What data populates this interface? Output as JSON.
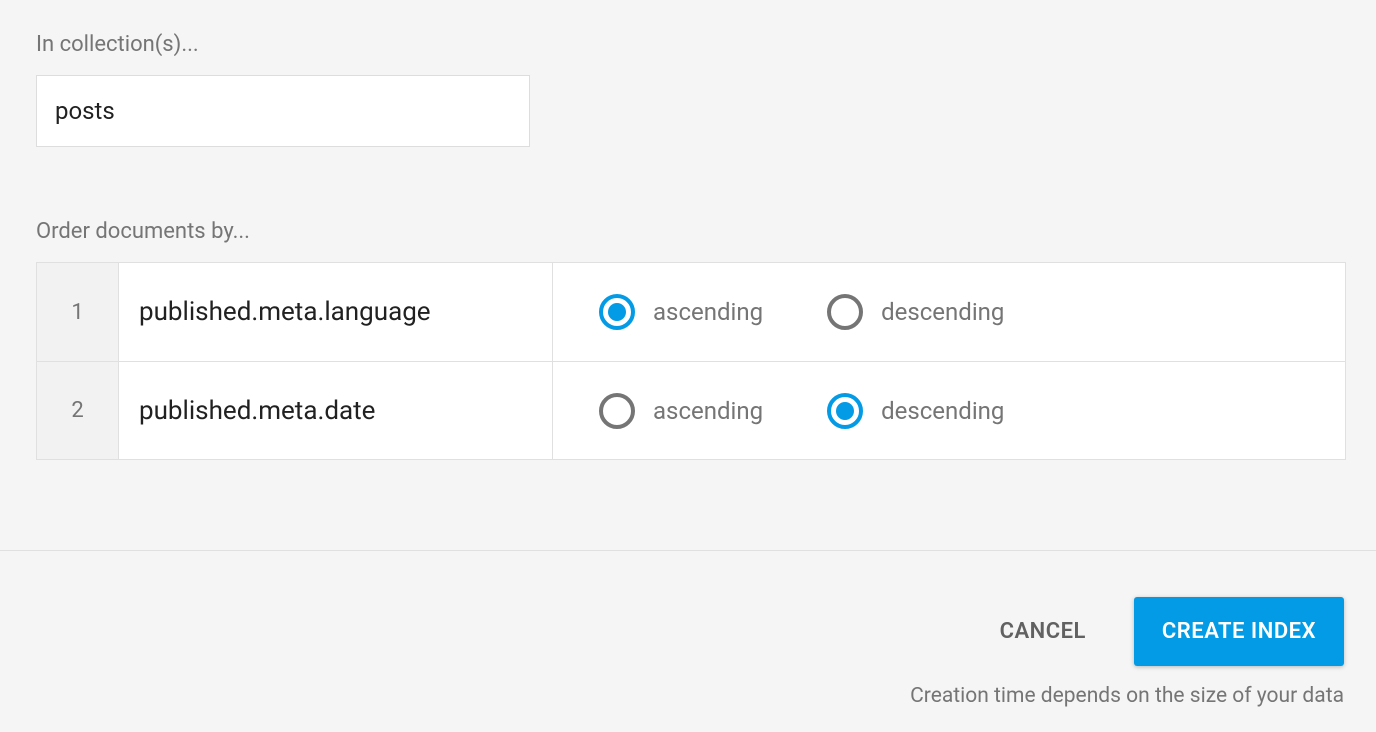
{
  "collection": {
    "label": "In collection(s)...",
    "value": "posts"
  },
  "order": {
    "label": "Order documents by...",
    "rows": [
      {
        "num": "1",
        "field": "published.meta.language",
        "asc_label": "ascending",
        "desc_label": "descending",
        "selected": "asc"
      },
      {
        "num": "2",
        "field": "published.meta.date",
        "asc_label": "ascending",
        "desc_label": "descending",
        "selected": "desc"
      }
    ]
  },
  "footer": {
    "cancel": "CANCEL",
    "create": "CREATE INDEX",
    "hint": "Creation time depends on the size of your data"
  }
}
